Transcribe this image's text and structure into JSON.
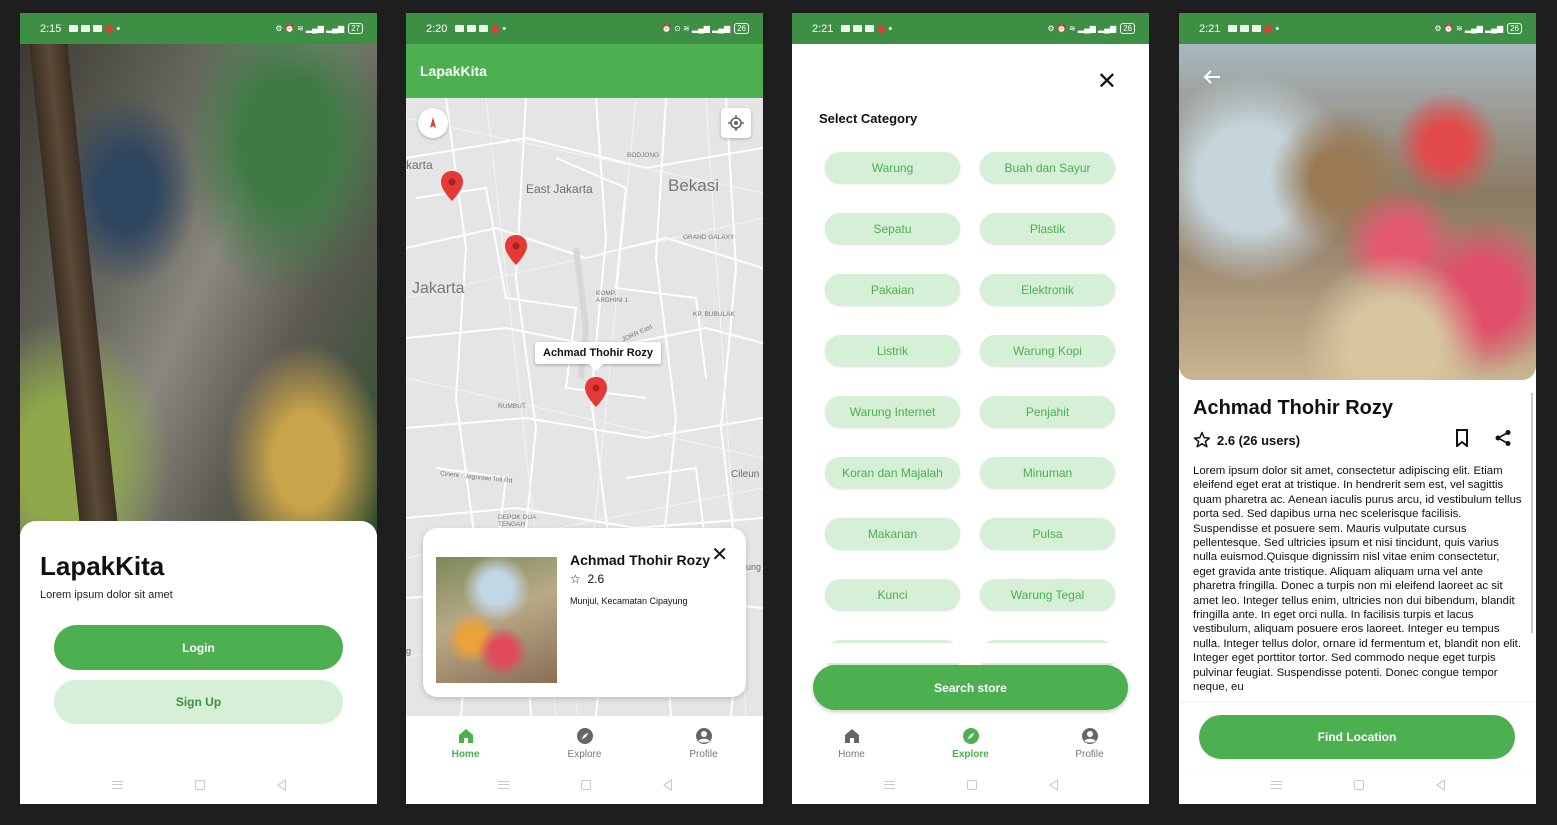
{
  "status_bars": {
    "p1_time": "2:15",
    "p1_battery": "27",
    "p2_time": "2:20",
    "p2_battery": "26",
    "p3_time": "2:21",
    "p3_battery": "26",
    "p4_time": "2:21",
    "p4_battery": "26"
  },
  "welcome": {
    "app_name": "LapakKita",
    "tagline": "Lorem ipsum dolor sit amet",
    "login_label": "Login",
    "signup_label": "Sign Up"
  },
  "map_screen": {
    "app_title": "LapakKita",
    "map_labels": {
      "jakarta_top": "karta",
      "east_jakarta": "East Jakarta",
      "bekasi": "Bekasi",
      "jakarta": "Jakarta",
      "bodjong": "BODJONG",
      "grand_galaxy": "GRAND GALAXY",
      "komp_ardhini": "KOMP. ARDHINI 1",
      "kp_bubulak": "KP. BUBULAK",
      "rumbut": "RUMBUT",
      "cileungsi": "Cileun",
      "depok_dua": "DEPOK DUA TENGAH",
      "cinere": "Cinere - Jagorawi Toll Rd",
      "jorr_east": "JORR East",
      "left_g": "g",
      "right_ung": "ung"
    },
    "marker_infowindow": "Achmad Thohir Rozy",
    "store_card": {
      "name": "Achmad Thohir Rozy",
      "rating": "2.6",
      "address": "Munjul, Kecamatan Cipayung"
    }
  },
  "bottom_nav": {
    "home": "Home",
    "explore": "Explore",
    "profile": "Profile"
  },
  "category_screen": {
    "title": "Select Category",
    "categories": [
      "Warung",
      "Buah dan Sayur",
      "Sepatu",
      "Plastik",
      "Pakaian",
      "Elektronik",
      "Listrik",
      "Warung Kopi",
      "Warung Internet",
      "Penjahit",
      "Koran dan Majalah",
      "Minuman",
      "Makanan",
      "Pulsa",
      "Kunci",
      "Warung Tegal"
    ],
    "search_label": "Search store"
  },
  "detail_screen": {
    "store_name": "Achmad Thohir Rozy",
    "rating_text": "2.6 (26 users)",
    "description": "Lorem ipsum dolor sit amet, consectetur adipiscing elit. Etiam eleifend eget erat at tristique. In hendrerit sem est, vel sagittis quam pharetra ac. Aenean iaculis purus arcu, id vestibulum tellus porta sed. Sed dapibus urna nec scelerisque facilisis. Suspendisse et posuere sem. Mauris vulputate cursus pellentesque. Sed ultricies ipsum et nisi tincidunt, quis varius nulla euismod.Quisque dignissim nisl vitae enim consectetur, eget gravida ante tristique. Aliquam aliquam urna vel ante pharetra fringilla. Donec a turpis non mi eleifend laoreet ac sit amet leo. Integer tellus enim, ultricies non dui bibendum, blandit fringilla ante. In eget orci nulla. In facilisis turpis et lacus vestibulum, aliquam posuere eros laoreet. Integer eu tempus nulla. Integer tellus dolor, ornare id fermentum et, blandit non elit. Integer eget porttitor tortor. Sed commodo neque eget turpis pulvinar feugiat. Suspendisse potenti. Donec congue tempor neque, eu",
    "find_location_label": "Find Location"
  },
  "colors": {
    "primary": "#4caf50",
    "primary_dark": "#3d8f44",
    "chip_bg": "#d6efd7",
    "pin_red": "#e53935"
  }
}
